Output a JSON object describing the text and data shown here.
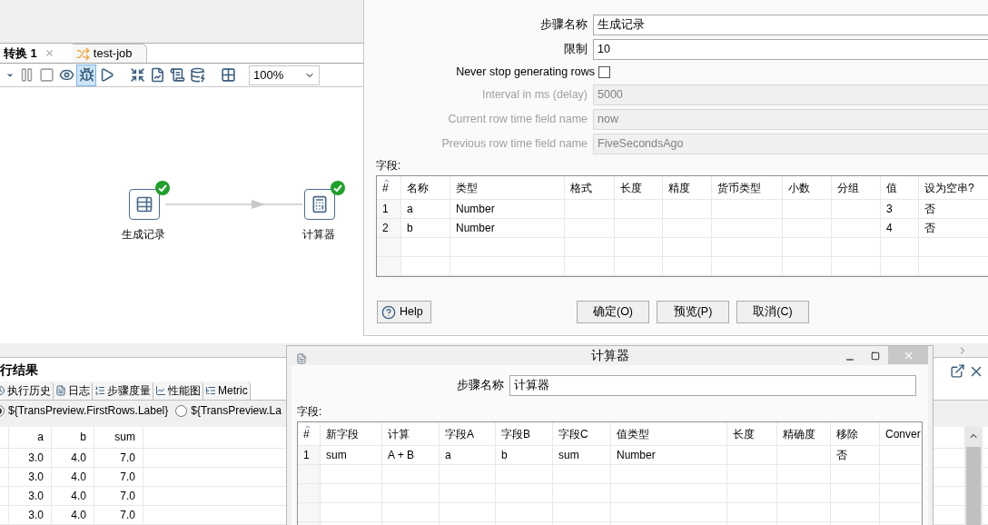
{
  "main_window": {
    "tabs": [
      {
        "label": "转换 1",
        "selected": true,
        "kind": "transformation"
      },
      {
        "label": "test-job",
        "selected": false,
        "kind": "job"
      }
    ],
    "toolbar": {
      "buttons": [
        {
          "kind": "caret",
          "pressed": false
        },
        {
          "kind": "pause",
          "pressed": false
        },
        {
          "kind": "stop",
          "pressed": false
        },
        {
          "kind": "preview",
          "pressed": false
        },
        {
          "kind": "debug",
          "pressed": true
        },
        {
          "kind": "replay",
          "pressed": false
        },
        {
          "kind": "verify",
          "pressed": false
        },
        {
          "kind": "impact",
          "pressed": false
        },
        {
          "kind": "sql",
          "pressed": false
        },
        {
          "kind": "explore",
          "pressed": false
        },
        {
          "kind": "grid",
          "pressed": false
        }
      ],
      "zoom": "100%"
    },
    "canvas": {
      "steps": [
        {
          "label": "生成记录",
          "kind": "generator",
          "completed": true
        },
        {
          "label": "计算器",
          "kind": "calculator",
          "completed": true
        }
      ]
    },
    "results_panel": {
      "title": "行结果",
      "tabs": [
        {
          "label": "执行历史",
          "kind": "history",
          "selected": false
        },
        {
          "label": "日志",
          "kind": "log",
          "selected": false
        },
        {
          "label": "步骤度量",
          "kind": "metrics",
          "selected": false
        },
        {
          "label": "性能图",
          "kind": "chart",
          "selected": false
        },
        {
          "label": "Metric",
          "kind": "tree",
          "selected": false
        }
      ],
      "preview_options": [
        {
          "label": "${TransPreview.FirstRows.Label}",
          "selected": true
        },
        {
          "label": "${TransPreview.La",
          "selected": false
        }
      ],
      "table": {
        "columns": [
          "a",
          "b",
          "sum"
        ],
        "rows": [
          [
            "3.0",
            "4.0",
            "7.0"
          ],
          [
            "3.0",
            "4.0",
            "7.0"
          ],
          [
            "3.0",
            "4.0",
            "7.0"
          ],
          [
            "3.0",
            "4.0",
            "7.0"
          ]
        ]
      }
    }
  },
  "generate_rows_dialog": {
    "fields": [
      {
        "label": "步骤名称",
        "value": "生成记录",
        "disabled": false
      },
      {
        "label": "限制",
        "value": "10",
        "disabled": false
      }
    ],
    "never_stop": {
      "label": "Never stop generating rows",
      "checked": false
    },
    "time_fields": [
      {
        "label": "Interval in ms (delay)",
        "value": "5000",
        "disabled": true
      },
      {
        "label": "Current row time field name",
        "value": "now",
        "disabled": true
      },
      {
        "label": "Previous row time field name",
        "value": "FiveSecondsAgo",
        "disabled": true
      }
    ],
    "fields_label": "字段:",
    "table": {
      "columns": [
        "#",
        "名称",
        "类型",
        "格式",
        "长度",
        "精度",
        "货币类型",
        "小数",
        "分组",
        "值",
        "设为空串?"
      ],
      "rows": [
        [
          "1",
          "a",
          "Number",
          "",
          "",
          "",
          "",
          "",
          "",
          "3",
          "否"
        ],
        [
          "2",
          "b",
          "Number",
          "",
          "",
          "",
          "",
          "",
          "",
          "4",
          "否"
        ]
      ]
    },
    "help_button": "Help",
    "buttons": [
      "确定(O)",
      "预览(P)",
      "取消(C)"
    ]
  },
  "calculator_dialog": {
    "title": "计算器",
    "step_name": {
      "label": "步骤名称",
      "value": "计算器"
    },
    "fields_label": "字段:",
    "table": {
      "columns": [
        "#",
        "新字段",
        "计算",
        "字段A",
        "字段B",
        "字段C",
        "值类型",
        "长度",
        "精确度",
        "移除",
        "Conver"
      ],
      "rows": [
        [
          "1",
          "sum",
          "A + B",
          "a",
          "b",
          "sum",
          "Number",
          "",
          "",
          "否",
          ""
        ]
      ]
    }
  }
}
